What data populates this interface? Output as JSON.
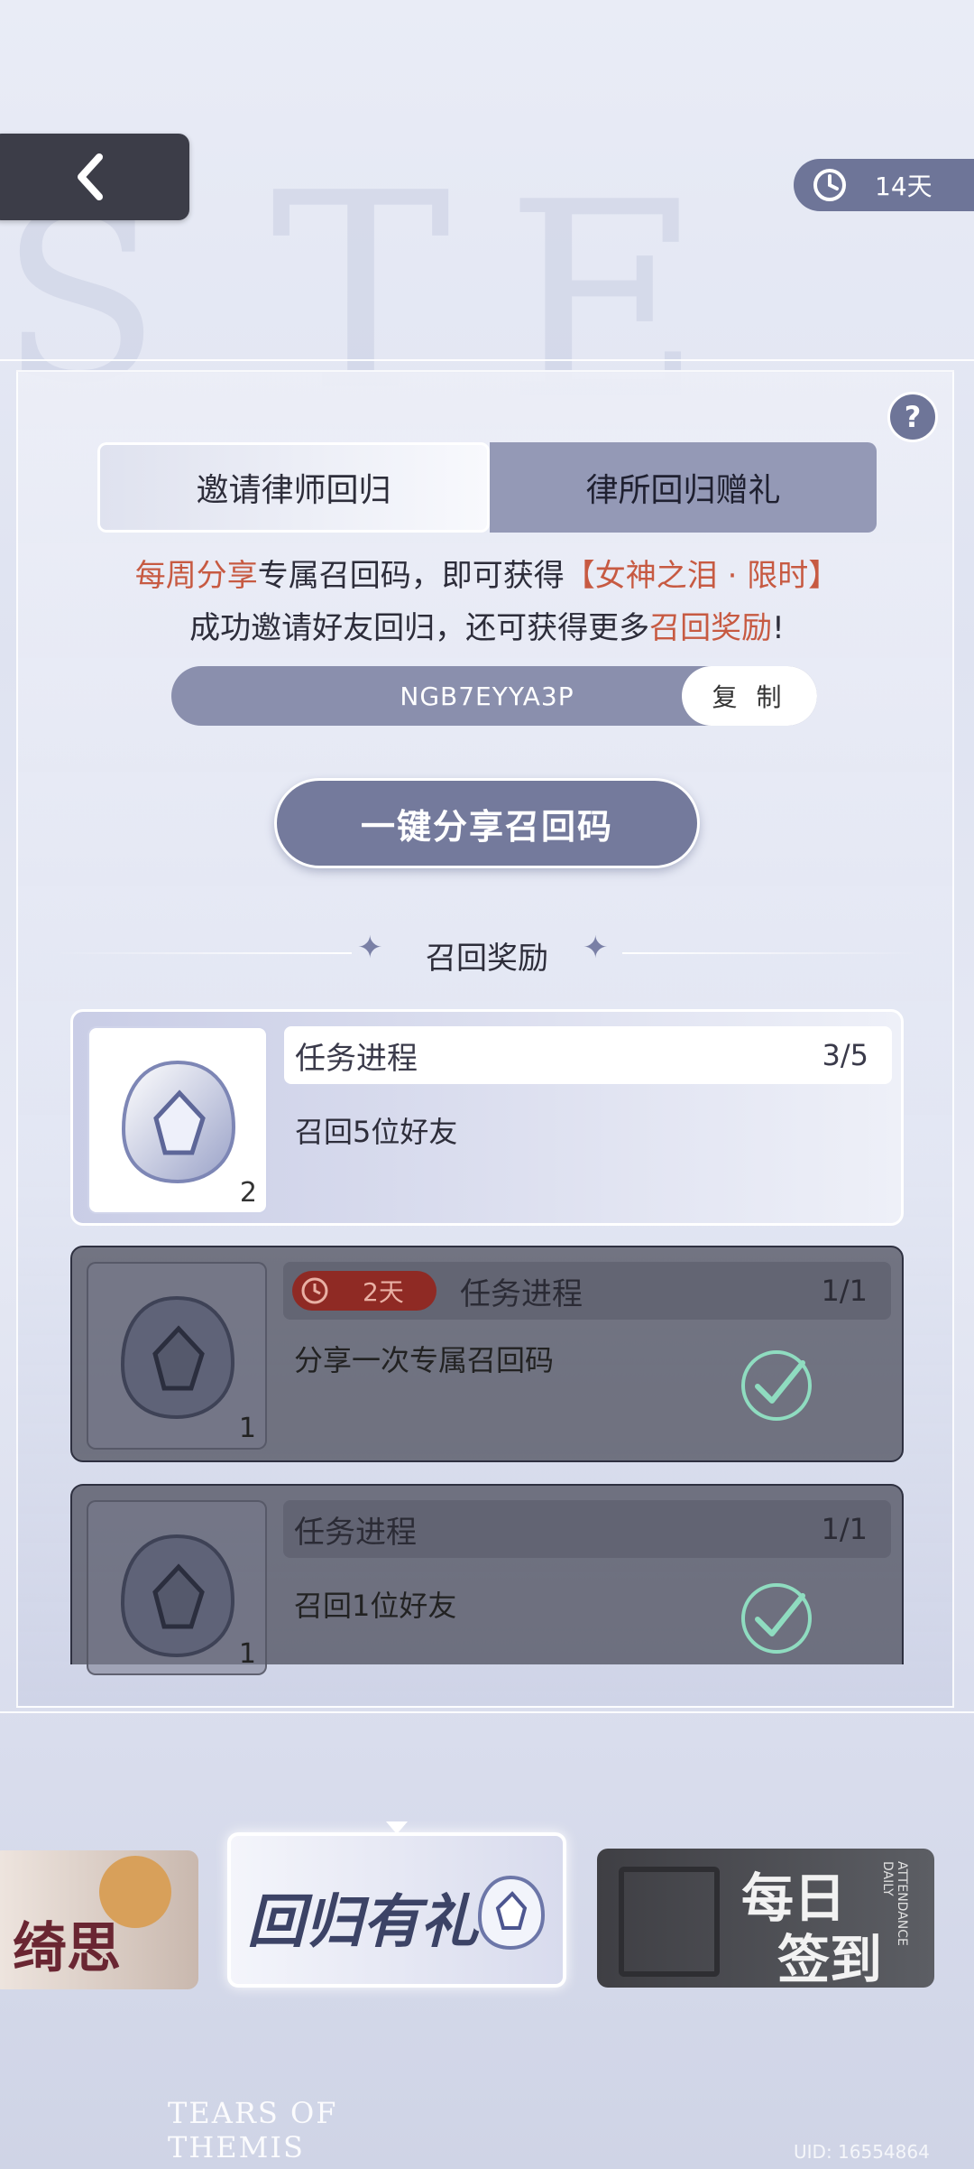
{
  "header": {
    "back_icon": "chevron-left-icon",
    "timer_icon": "clock-icon",
    "timer_value": "14天"
  },
  "tabs": [
    {
      "label": "邀请律师回归",
      "active": true
    },
    {
      "label": "律所回归赠礼",
      "active": false
    }
  ],
  "help_label": "?",
  "description": {
    "line1_a": "每周分享",
    "line1_b": "专属召回码，即可获得",
    "line1_c": "【女神之泪 · 限时】",
    "line2_a": "成功邀请好友回归，还可获得更多",
    "line2_b": "召回奖励",
    "line2_c": "!"
  },
  "recall_code": {
    "value": "NGB7EYYA3P",
    "copy_label": "复 制"
  },
  "share_button": "一键分享召回码",
  "rewards_title": "召回奖励",
  "tasks": [
    {
      "reward_count": "2",
      "progress_label": "任务进程",
      "progress": "3/5",
      "title": "召回5位好友",
      "completed": false,
      "badge": ""
    },
    {
      "reward_count": "1",
      "progress_label": "任务进程",
      "progress": "1/1",
      "title": "分享一次专属召回码",
      "completed": true,
      "badge": "2天"
    },
    {
      "reward_count": "1",
      "progress_label": "任务进程",
      "progress": "1/1",
      "title": "召回1位好友",
      "completed": true,
      "badge": ""
    }
  ],
  "bottom_nav": {
    "item1": "绮思",
    "item2": "回归有礼",
    "item3_line1": "每日",
    "item3_line2": "签到",
    "item3_side": "ATTENDANCE DAILY"
  },
  "footer": {
    "logo_line1": "TEARS OF",
    "logo_line2": "THEMIS",
    "uid": "UID: 16554864"
  },
  "colors": {
    "accent": "#6e7598",
    "highlight_red": "#c75a42",
    "check_green": "#8fdcc0"
  }
}
